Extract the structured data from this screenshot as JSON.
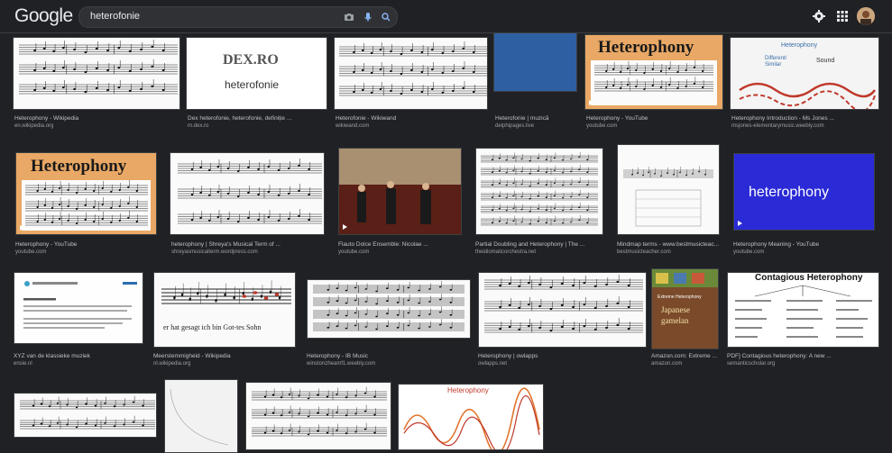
{
  "header": {
    "logo": "Google",
    "search_value": "heterofonie"
  },
  "results": [
    {
      "title": "Heterophony - Wikipedia",
      "source": "en.wikipedia.org"
    },
    {
      "title": "Dex heterofonie, heterofonie, definiție ...",
      "source": "m.dex.ro",
      "img_line1": "DEX.RO",
      "img_line2": "heterofonie"
    },
    {
      "title": "Heterofonie - Wikiwand",
      "source": "wikiwand.com"
    },
    {
      "title": "Heterofonie | muzică",
      "source": "delphipages.live"
    },
    {
      "title": "Heterophony - YouTube",
      "source": "youtube.com",
      "img_text": "Heterophony"
    },
    {
      "title": "Heterophony Introduction - Ms Jones ...",
      "source": "msjones-elementarymusic.weebly.com",
      "img_title": "Heterophony",
      "img_label1": "Different/",
      "img_label2": "Similar",
      "img_label3": "Sound"
    },
    {
      "title": "Heterophony - YouTube",
      "source": "youtube.com",
      "img_text": "Heterophony"
    },
    {
      "title": "heterophony | Shreya's Musical Term of ...",
      "source": "shreyasmusicalterm.wordpress.com"
    },
    {
      "title": "Flauto Dolce Ensemble: Nicolae ...",
      "source": "youtube.com"
    },
    {
      "title": "Partial Doubling and Heterophony | The ...",
      "source": "theidiomaticorchestra.net"
    },
    {
      "title": "Mindmap terms - www.bestmusicteac...",
      "source": "bestmusicteacher.com"
    },
    {
      "title": "Heterophony Meaning - YouTube",
      "source": "youtube.com",
      "img_text": "heterophony"
    },
    {
      "title": "XYZ van de klassieke muziek",
      "source": "ensie.nl"
    },
    {
      "title": "Meerstemmigheid - Wikipedia",
      "source": "nl.wikipedia.org",
      "img_lyric": "er hat gesagt ich bin   Got-tes Sohn"
    },
    {
      "title": "Heterophony - IB Music",
      "source": "winstonzheamf1.weebly.com"
    },
    {
      "title": "Heterophony | owlapps",
      "source": "owlapps.net"
    },
    {
      "title": "Amazon.com: Extreme ...",
      "source": "amazon.com",
      "img_line1": "Extreme Heterophony",
      "img_line2": "Japanese",
      "img_line3": "gamelan"
    },
    {
      "title": "PDF] Contagious heterophony: A new ...",
      "source": "semanticscholar.org",
      "img_title": "Contagious Heterophony"
    },
    {
      "title": "",
      "source": ""
    },
    {
      "title": "",
      "source": ""
    },
    {
      "title": "",
      "source": ""
    },
    {
      "title": "",
      "source": "",
      "img_title": "Heterophony"
    }
  ]
}
